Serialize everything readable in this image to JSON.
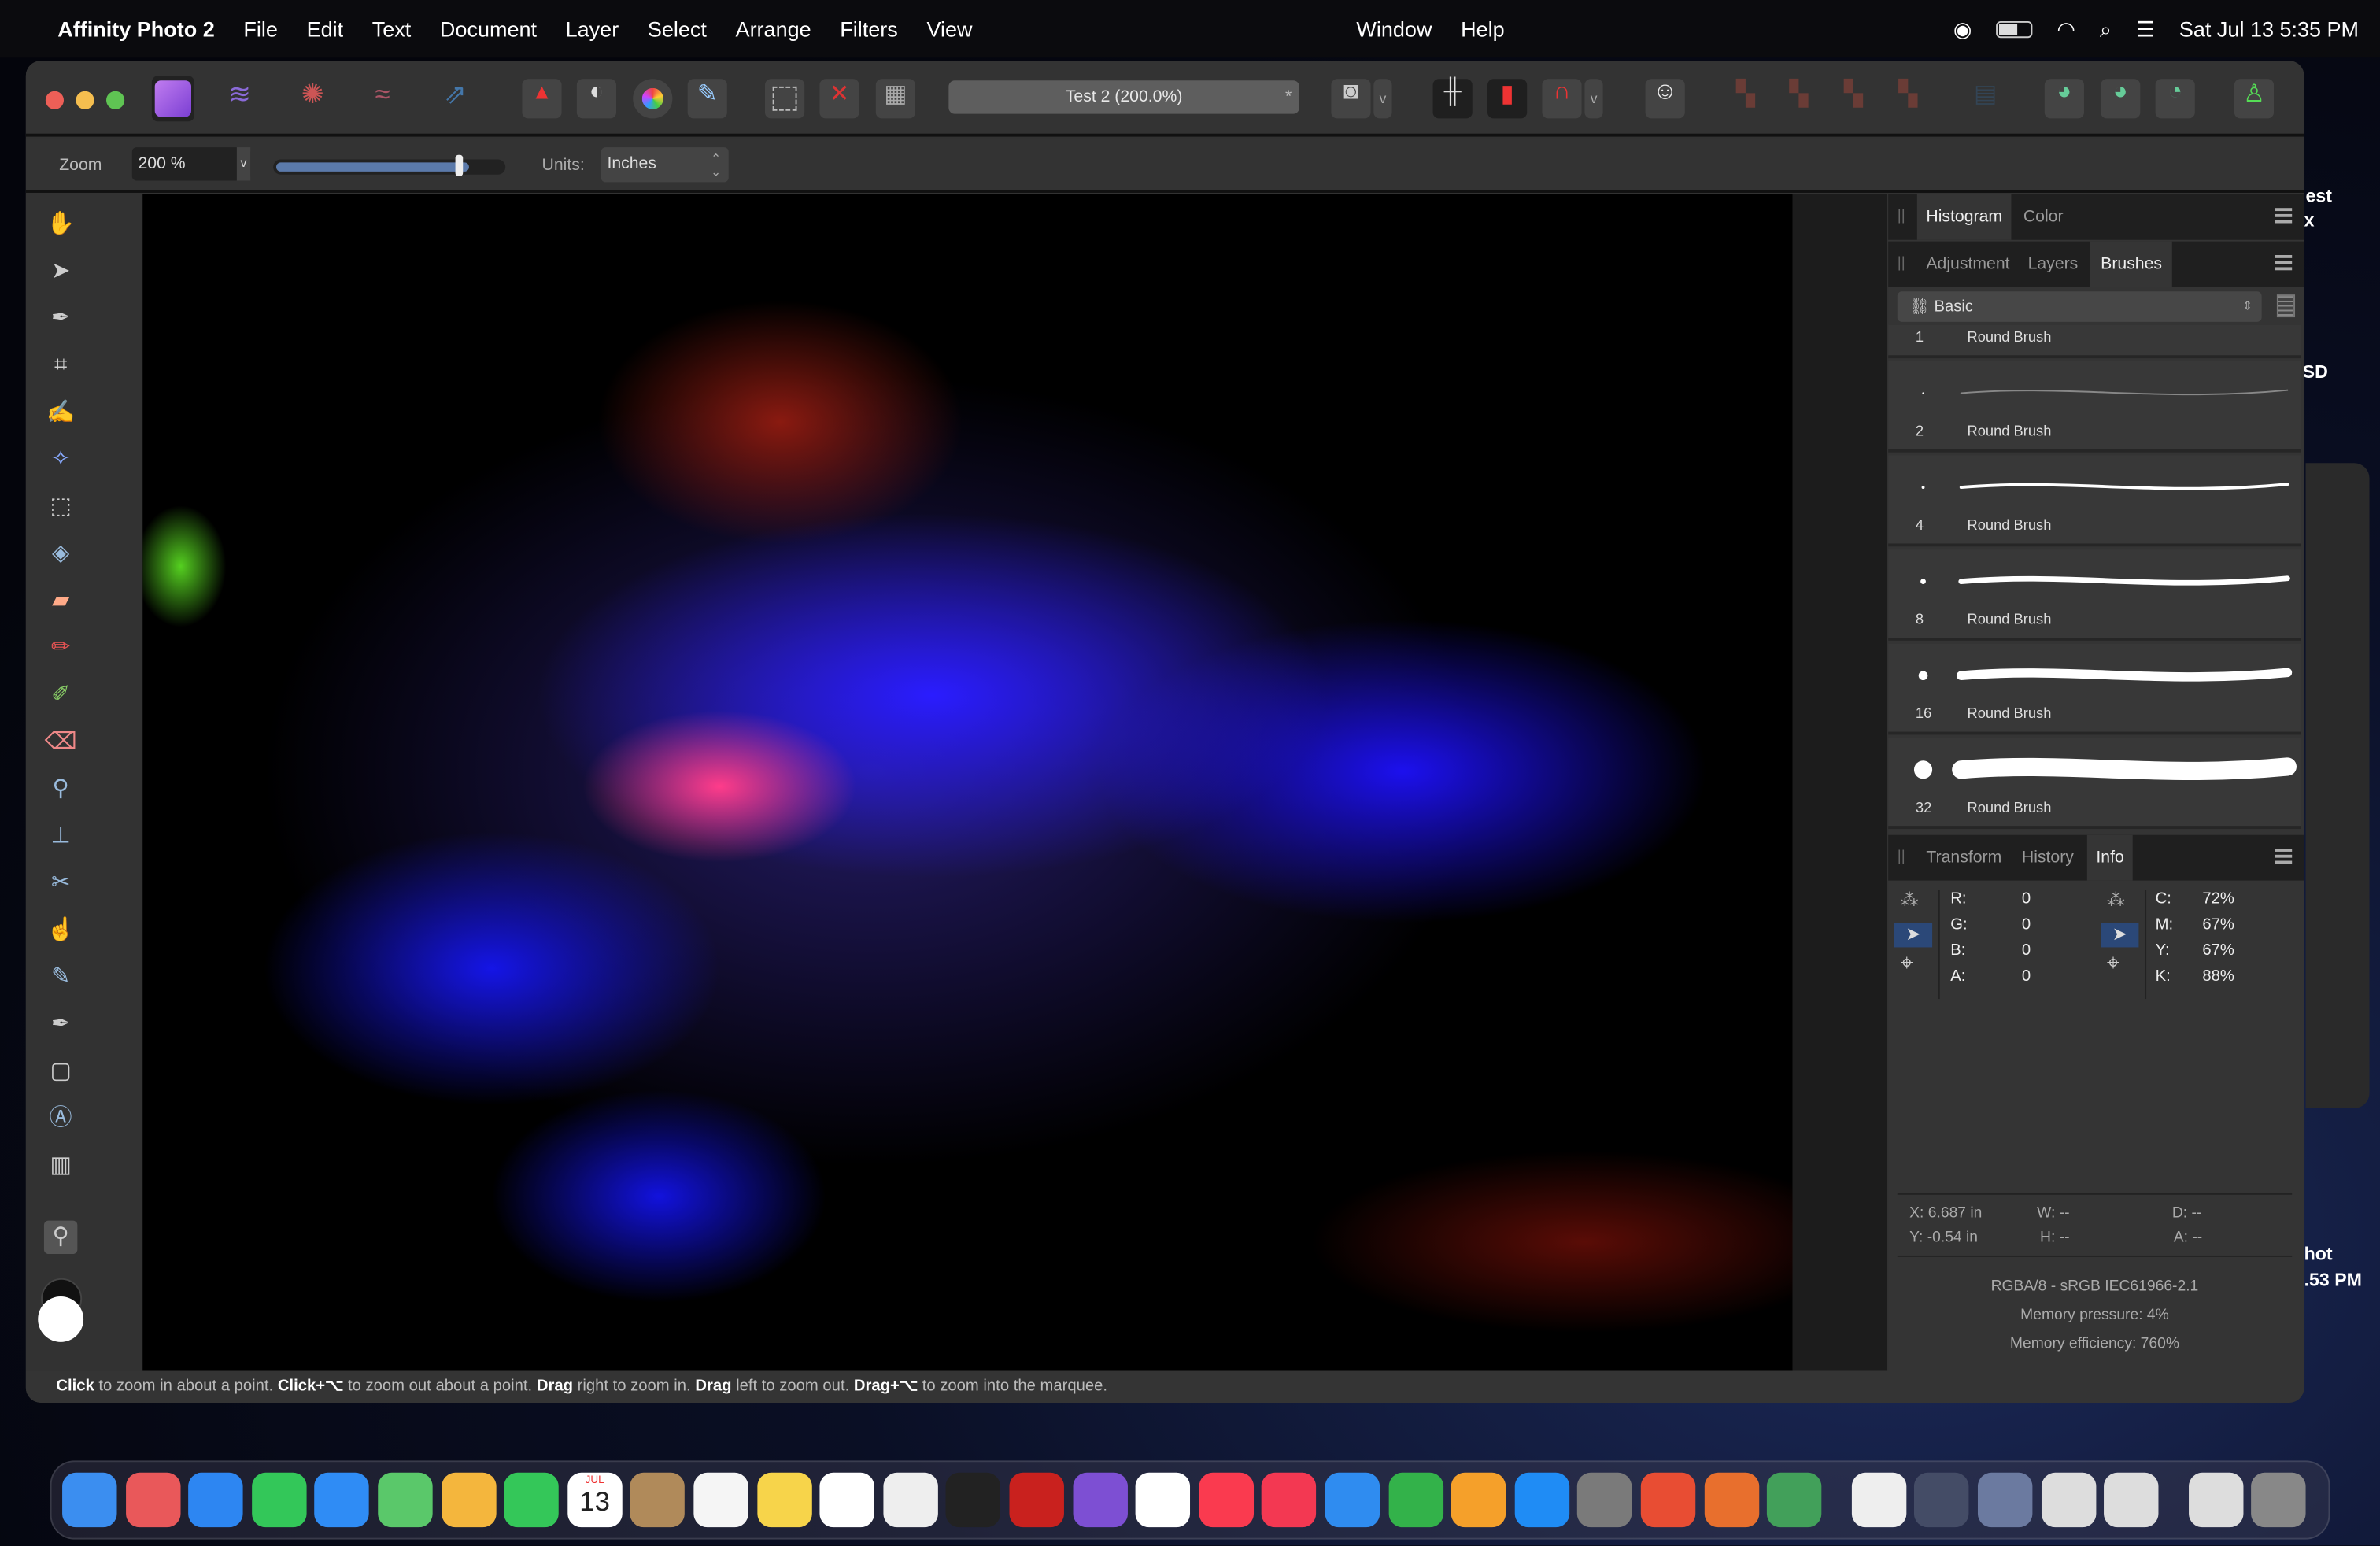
{
  "menubar": {
    "app_name": "Affinity Photo 2",
    "items": [
      "File",
      "Edit",
      "Text",
      "Document",
      "Layer",
      "Select",
      "Arrange",
      "Filters",
      "View"
    ],
    "items_right": [
      "Window",
      "Help"
    ],
    "datetime": "Sat Jul 13  5:35 PM",
    "status_icons": [
      "screen-record-icon",
      "battery-icon",
      "wifi-icon",
      "search-icon",
      "control-center-icon"
    ]
  },
  "toolbar": {
    "document_title": "Test 2 (200.0%)",
    "personas": [
      "photo-persona-icon",
      "liquify-persona-icon",
      "develop-persona-icon",
      "tone-mapping-persona-icon",
      "export-persona-icon"
    ]
  },
  "context": {
    "zoom_label": "Zoom",
    "zoom_value": "200 %",
    "zoom_slider_fraction": 0.83,
    "units_label": "Units:",
    "units_value": "Inches"
  },
  "panels": {
    "top_tabs": [
      "Histogram",
      "Color"
    ],
    "top_active": "Histogram",
    "mid_tabs": [
      "Adjustment",
      "Layers",
      "Brushes"
    ],
    "mid_active": "Brushes",
    "brush_category": "Basic",
    "brushes": [
      {
        "size": "1",
        "name": "Round Brush"
      },
      {
        "size": "2",
        "name": "Round Brush"
      },
      {
        "size": "4",
        "name": "Round Brush"
      },
      {
        "size": "8",
        "name": "Round Brush"
      },
      {
        "size": "16",
        "name": "Round Brush"
      },
      {
        "size": "32",
        "name": "Round Brush"
      }
    ],
    "bottom_tabs": [
      "Transform",
      "History",
      "Info"
    ],
    "bottom_active": "Info",
    "info": {
      "rgba": [
        [
          "R:",
          "0"
        ],
        [
          "G:",
          "0"
        ],
        [
          "B:",
          "0"
        ],
        [
          "A:",
          "0"
        ]
      ],
      "cmyk": [
        [
          "C:",
          "72%"
        ],
        [
          "M:",
          "67%"
        ],
        [
          "Y:",
          "67%"
        ],
        [
          "K:",
          "88%"
        ]
      ],
      "x": "X: 6.687 in",
      "y": "Y: -0.54 in",
      "w": "W: --",
      "h": "H: --",
      "d": "D: --",
      "a": "A: --",
      "color_format": "RGBA/8 - sRGB IEC61966-2.1",
      "memory_pressure": "Memory pressure: 4%",
      "memory_efficiency": "Memory efficiency: 760%"
    }
  },
  "status": {
    "parts": [
      [
        "Click",
        " to zoom in about a point. "
      ],
      [
        "Click+⌥",
        " to zoom out about a point. "
      ],
      [
        "Drag",
        " right to zoom in. "
      ],
      [
        "Drag",
        " left to zoom out. "
      ],
      [
        "Drag+⌥",
        " to zoom into the marquee."
      ]
    ]
  },
  "desktop": {
    "labels": [
      "est",
      "x",
      "SD",
      "hot",
      ".53 PM"
    ]
  },
  "dock": {
    "apps": [
      "Finder",
      "Launchpad",
      "Safari",
      "Messages",
      "Mail",
      "Maps",
      "Photos",
      "FaceTime",
      "Calendar",
      "Contacts",
      "Reminders",
      "Notes",
      "Freeform",
      "TextEdit",
      "TV",
      "FileZilla",
      "Affinity Photo 2",
      "Chrome",
      "Music",
      "News",
      "Keynote",
      "Numbers",
      "Pages",
      "App Store",
      "System Settings",
      "Toolbox Word",
      "Toolbox PowerPoint",
      "Toolbox Pages",
      "Preview",
      "QuickTime",
      "Screenshot",
      "Documents",
      "Downloads",
      "Screenshots",
      "Trash"
    ],
    "calendar_month": "JUL",
    "calendar_day": "13",
    "colors": [
      "#3b8ef0",
      "#e9585a",
      "#2d86f2",
      "#33c759",
      "#2f8cf5",
      "#5ac86a",
      "#f4b63d",
      "#34c759",
      "#ffffff",
      "#b08a5a",
      "#f5f5f5",
      "#f7d44a",
      "#ffffff",
      "#eeeeee",
      "#222222",
      "#c9211e",
      "#7d4fd3",
      "#ffffff",
      "#fa3a4f",
      "#f33852",
      "#2f8cf0",
      "#33b24a",
      "#f5a02a",
      "#1f8cf5",
      "#7a7a7a",
      "#e84d33",
      "#e86f2d",
      "#42a05a",
      "#eeeeee",
      "#444c66",
      "#6b7aa0",
      "#dddddd",
      "#dddddd",
      "#dddddd",
      "#888888"
    ]
  }
}
